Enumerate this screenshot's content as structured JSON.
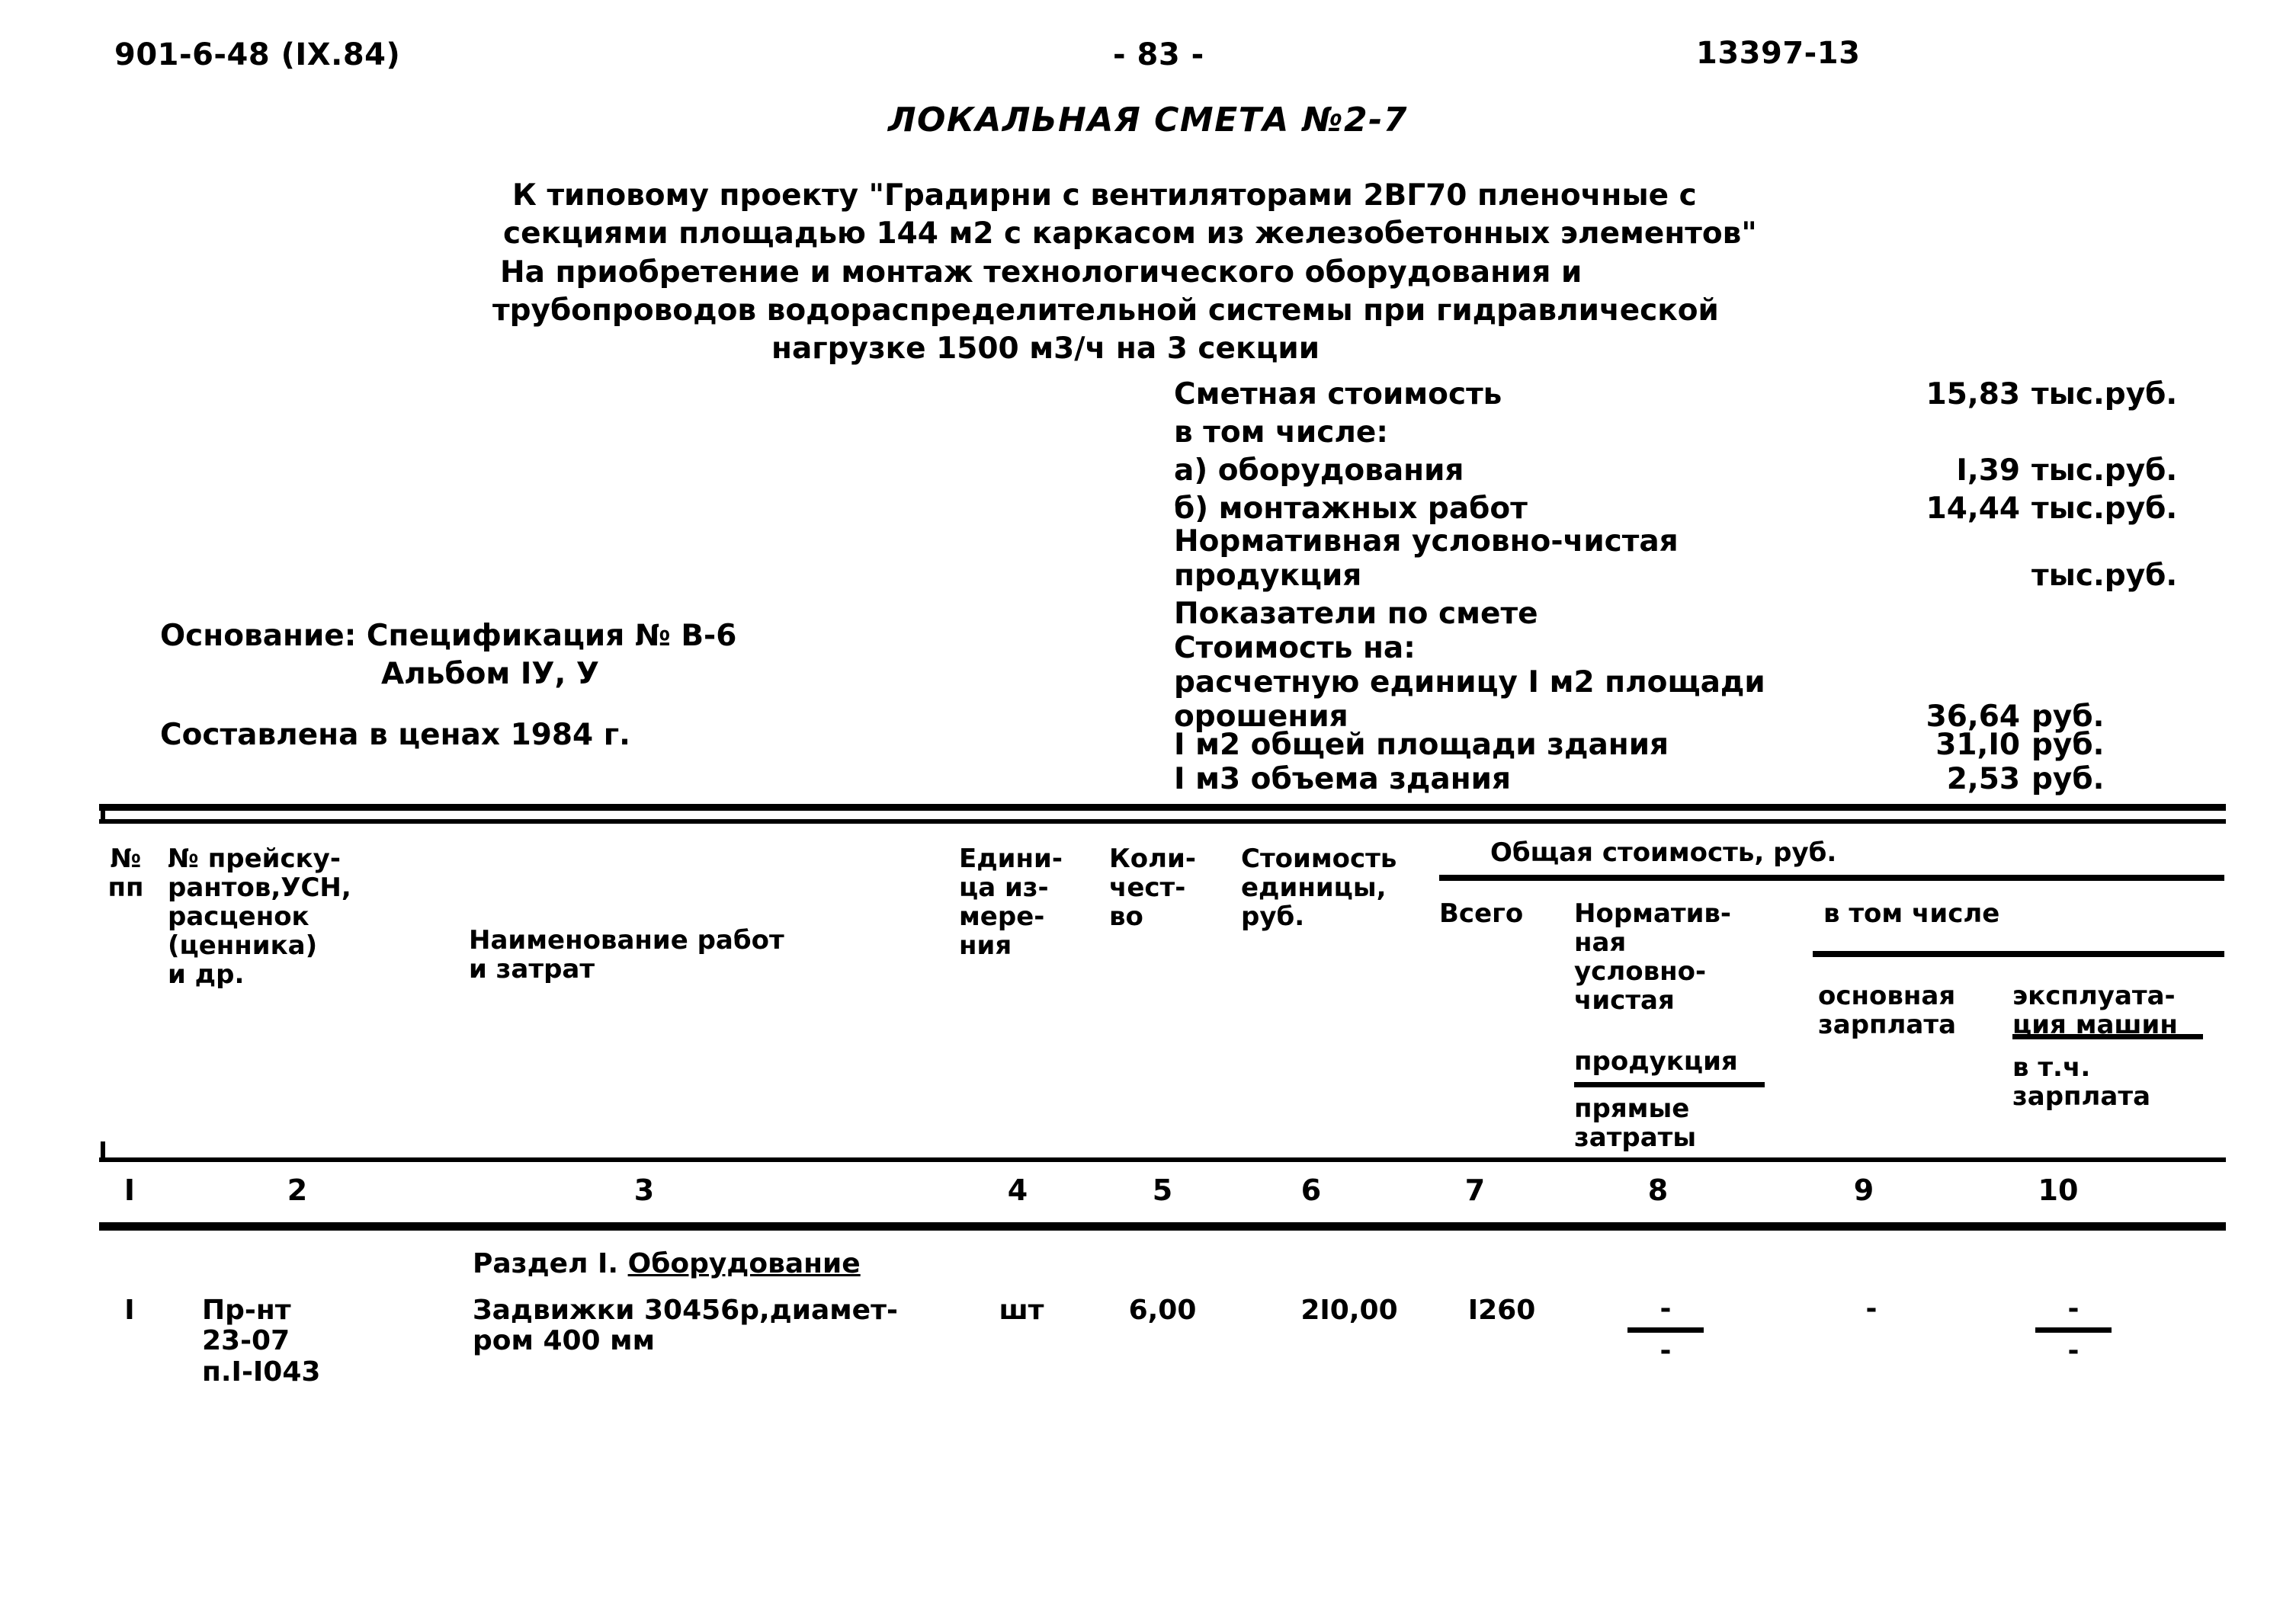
{
  "header": {
    "left_code": "901-6-48 (IX.84)",
    "page_number": "- 83 -",
    "right_code": "13397-13"
  },
  "title": "ЛОКАЛЬНАЯ СМЕТА №2-7",
  "intro": {
    "line1": "К типовому проекту \"Градирни с вентиляторами 2ВГ70 пленочные с",
    "line2": "секциями площадью 144 м2 с каркасом из железобетонных элементов\"",
    "line3": "На приобретение и монтаж технологического оборудования и",
    "line4": "трубопроводов водораспределительной системы при гидравлической",
    "line5": "нагрузке 1500 м3/ч на 3 секции"
  },
  "summary": [
    {
      "label": "Сметная стоимость",
      "value": "15,83",
      "unit": "тыс.руб."
    },
    {
      "label": "в том числе:",
      "value": "",
      "unit": ""
    },
    {
      "label": "а) оборудования",
      "value": "I,39",
      "unit": "тыс.руб."
    },
    {
      "label": "б) монтажных работ",
      "value": "14,44",
      "unit": "тыс.руб."
    },
    {
      "label": "Нормативная условно-чистая",
      "value": "",
      "unit": ""
    },
    {
      "label": "продукция",
      "value": "",
      "unit": "тыс.руб."
    },
    {
      "label": "Показатели по смете",
      "value": "",
      "unit": ""
    },
    {
      "label": "Стоимость на:",
      "value": "",
      "unit": ""
    },
    {
      "label": "расчетную единицу I м2 площади",
      "value": "",
      "unit": ""
    },
    {
      "label": "орошения",
      "value": "36,64",
      "unit": "руб."
    },
    {
      "label": "I м2 общей площади здания",
      "value": "31,I0",
      "unit": "руб."
    },
    {
      "label": "I м3 объема здания",
      "value": "2,53",
      "unit": "руб."
    }
  ],
  "basis": {
    "line1": "Основание: Спецификация № В-6",
    "line2": "Альбом IУ, У",
    "line3": "Составлена в ценах 1984 г."
  },
  "table": {
    "headers": {
      "col1": "№\nпп",
      "col2": "№ прейску-\nрантов,УСН,\nрасценок\n(ценника)\nи др.",
      "col3": "Наименование работ\nи затрат",
      "col4": "Едини-\nца из-\nмере-\nния",
      "col5": "Коли-\nчест-\nво",
      "col6": "Стоимость\nединицы,\nруб.",
      "group_total": "Общая стоимость, руб.",
      "col7": "Всего",
      "col8_a": "Норматив-\nная\nусловно-\nчистая",
      "col8_b": "продукция",
      "col8_c": "прямые\nзатраты",
      "group_incl": "в том числе",
      "col9": "основная\nзарплата",
      "col10_a": "эксплуата-\nция машин",
      "col10_b": "в т.ч.\nзарплата"
    },
    "column_numbers": [
      "I",
      "2",
      "3",
      "4",
      "5",
      "6",
      "7",
      "8",
      "9",
      "10"
    ],
    "section": {
      "prefix": "Раздел I. ",
      "name": "Оборудование"
    },
    "rows": [
      {
        "col1": "I",
        "col2": "Пр-нт\n23-07\nп.I-I043",
        "col3": "Задвижки 30456р,диамет-\nром 400 мм",
        "col4": "шт",
        "col5": "6,00",
        "col6": "2I0,00",
        "col7": "I260",
        "col8": {
          "top": "-",
          "bar": true,
          "bottom": "-"
        },
        "col9": {
          "top": "-",
          "bar": false,
          "bottom": ""
        },
        "col10": {
          "top": "-",
          "bar": true,
          "bottom": "-"
        }
      }
    ]
  }
}
